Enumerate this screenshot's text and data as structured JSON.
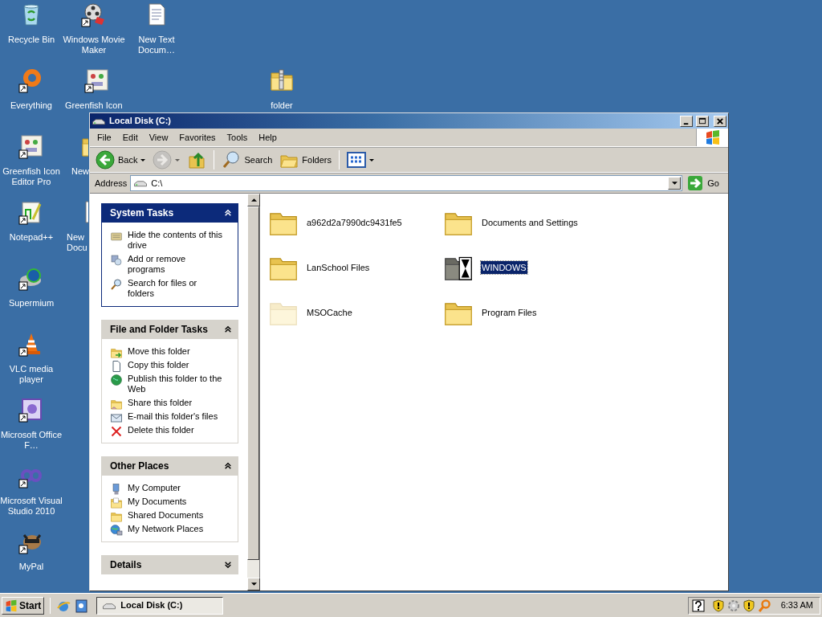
{
  "desktop": {
    "icons": [
      {
        "label": "Recycle Bin",
        "kind": "recycle",
        "shortcut": false
      },
      {
        "label": "Windows Movie Maker",
        "kind": "movie",
        "shortcut": true
      },
      {
        "label": "New Text Docum…",
        "kind": "text",
        "shortcut": false
      },
      {
        "label": "Everything",
        "kind": "ring",
        "shortcut": true
      },
      {
        "label": "Greenfish Icon",
        "kind": "greenfish",
        "shortcut": true
      },
      {
        "label": "folder",
        "kind": "zip",
        "shortcut": false
      },
      {
        "label": "Greenfish Icon Editor Pro",
        "kind": "greenfish",
        "shortcut": true
      },
      {
        "label": "New",
        "kind": "folder"
      },
      {
        "label": "Notepad++",
        "kind": "notepadpp",
        "shortcut": true
      },
      {
        "label": "New Docu",
        "kind": "text"
      },
      {
        "label": "Supermium",
        "kind": "globe",
        "shortcut": true
      },
      {
        "label": "VLC media player",
        "kind": "cone",
        "shortcut": true
      },
      {
        "label": "Microsoft Office F…",
        "kind": "office",
        "shortcut": true
      },
      {
        "label": "Microsoft Visual Studio 2010",
        "kind": "infinity",
        "shortcut": true
      },
      {
        "label": "MyPal",
        "kind": "raccoon",
        "shortcut": true
      }
    ]
  },
  "window": {
    "title": "Local Disk (C:)",
    "menu": [
      "File",
      "Edit",
      "View",
      "Favorites",
      "Tools",
      "Help"
    ],
    "toolbar": [
      {
        "kind": "back",
        "label": "Back",
        "disabled": false
      },
      {
        "kind": "forward",
        "disabled": true
      },
      {
        "kind": "up",
        "disabled": false
      },
      {
        "kind": "search",
        "label": "Search",
        "disabled": false
      },
      {
        "kind": "folders",
        "label": "Folders",
        "disabled": false
      },
      {
        "kind": "views",
        "disabled": false
      }
    ],
    "address": {
      "label": "Address",
      "value": "C:\\",
      "go": "Go"
    },
    "task_panes": [
      {
        "title": "System Tasks",
        "kind": "special",
        "expanded": true,
        "items": [
          {
            "label": "Hide the contents of this drive"
          },
          {
            "label": "Add or remove programs"
          },
          {
            "label": "Search for files or folders"
          }
        ]
      },
      {
        "title": "File and Folder Tasks",
        "kind": "normal",
        "expanded": true,
        "items": [
          {
            "label": "Move this folder"
          },
          {
            "label": "Copy this folder"
          },
          {
            "label": "Publish this folder to the Web"
          },
          {
            "label": "Share this folder"
          },
          {
            "label": "E-mail this folder's files"
          },
          {
            "label": "Delete this folder"
          }
        ]
      },
      {
        "title": "Other Places",
        "kind": "normal",
        "expanded": true,
        "items": [
          {
            "label": "My Computer"
          },
          {
            "label": "My Documents"
          },
          {
            "label": "Shared Documents"
          },
          {
            "label": "My Network Places"
          }
        ]
      },
      {
        "title": "Details",
        "kind": "normal",
        "expanded": false
      }
    ],
    "files": [
      {
        "name": "a962d2a7990dc9431fe5",
        "kind": "folder",
        "hidden": false,
        "selected": false
      },
      {
        "name": "Documents and Settings",
        "kind": "folder",
        "hidden": false,
        "selected": false
      },
      {
        "name": "LanSchool Files",
        "kind": "folder",
        "hidden": false,
        "selected": false
      },
      {
        "name": "WINDOWS",
        "kind": "busy",
        "hidden": false,
        "selected": true
      },
      {
        "name": "MSOCache",
        "kind": "folder",
        "hidden": true,
        "selected": false
      },
      {
        "name": "Program Files",
        "kind": "folder",
        "hidden": false,
        "selected": false
      }
    ]
  },
  "taskbar": {
    "start": "Start",
    "quick_launch": [
      {
        "kind": "browser"
      },
      {
        "kind": "desktop"
      }
    ],
    "tasks": [
      {
        "label": "Local Disk (C:)",
        "selected": true
      }
    ],
    "tray": [
      {
        "kind": "help"
      },
      {
        "kind": "shield"
      },
      {
        "kind": "gear"
      },
      {
        "kind": "shield"
      },
      {
        "kind": "search"
      }
    ],
    "clock": "6:33 AM"
  }
}
